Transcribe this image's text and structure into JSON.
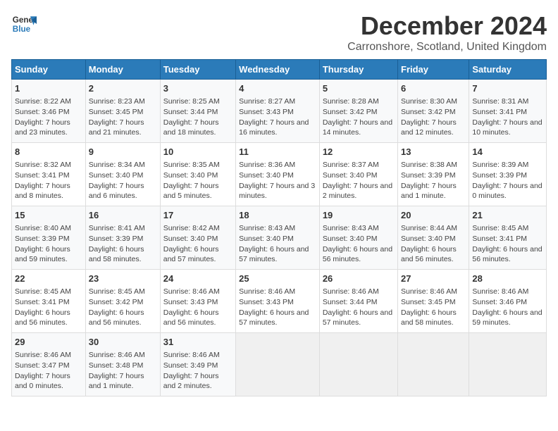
{
  "header": {
    "logo_line1": "General",
    "logo_line2": "Blue",
    "month": "December 2024",
    "location": "Carronshore, Scotland, United Kingdom"
  },
  "days_of_week": [
    "Sunday",
    "Monday",
    "Tuesday",
    "Wednesday",
    "Thursday",
    "Friday",
    "Saturday"
  ],
  "weeks": [
    [
      {
        "day": "1",
        "sunrise": "8:22 AM",
        "sunset": "3:46 PM",
        "daylight": "7 hours and 23 minutes."
      },
      {
        "day": "2",
        "sunrise": "8:23 AM",
        "sunset": "3:45 PM",
        "daylight": "7 hours and 21 minutes."
      },
      {
        "day": "3",
        "sunrise": "8:25 AM",
        "sunset": "3:44 PM",
        "daylight": "7 hours and 18 minutes."
      },
      {
        "day": "4",
        "sunrise": "8:27 AM",
        "sunset": "3:43 PM",
        "daylight": "7 hours and 16 minutes."
      },
      {
        "day": "5",
        "sunrise": "8:28 AM",
        "sunset": "3:42 PM",
        "daylight": "7 hours and 14 minutes."
      },
      {
        "day": "6",
        "sunrise": "8:30 AM",
        "sunset": "3:42 PM",
        "daylight": "7 hours and 12 minutes."
      },
      {
        "day": "7",
        "sunrise": "8:31 AM",
        "sunset": "3:41 PM",
        "daylight": "7 hours and 10 minutes."
      }
    ],
    [
      {
        "day": "8",
        "sunrise": "8:32 AM",
        "sunset": "3:41 PM",
        "daylight": "7 hours and 8 minutes."
      },
      {
        "day": "9",
        "sunrise": "8:34 AM",
        "sunset": "3:40 PM",
        "daylight": "7 hours and 6 minutes."
      },
      {
        "day": "10",
        "sunrise": "8:35 AM",
        "sunset": "3:40 PM",
        "daylight": "7 hours and 5 minutes."
      },
      {
        "day": "11",
        "sunrise": "8:36 AM",
        "sunset": "3:40 PM",
        "daylight": "7 hours and 3 minutes."
      },
      {
        "day": "12",
        "sunrise": "8:37 AM",
        "sunset": "3:40 PM",
        "daylight": "7 hours and 2 minutes."
      },
      {
        "day": "13",
        "sunrise": "8:38 AM",
        "sunset": "3:39 PM",
        "daylight": "7 hours and 1 minute."
      },
      {
        "day": "14",
        "sunrise": "8:39 AM",
        "sunset": "3:39 PM",
        "daylight": "7 hours and 0 minutes."
      }
    ],
    [
      {
        "day": "15",
        "sunrise": "8:40 AM",
        "sunset": "3:39 PM",
        "daylight": "6 hours and 59 minutes."
      },
      {
        "day": "16",
        "sunrise": "8:41 AM",
        "sunset": "3:39 PM",
        "daylight": "6 hours and 58 minutes."
      },
      {
        "day": "17",
        "sunrise": "8:42 AM",
        "sunset": "3:40 PM",
        "daylight": "6 hours and 57 minutes."
      },
      {
        "day": "18",
        "sunrise": "8:43 AM",
        "sunset": "3:40 PM",
        "daylight": "6 hours and 57 minutes."
      },
      {
        "day": "19",
        "sunrise": "8:43 AM",
        "sunset": "3:40 PM",
        "daylight": "6 hours and 56 minutes."
      },
      {
        "day": "20",
        "sunrise": "8:44 AM",
        "sunset": "3:40 PM",
        "daylight": "6 hours and 56 minutes."
      },
      {
        "day": "21",
        "sunrise": "8:45 AM",
        "sunset": "3:41 PM",
        "daylight": "6 hours and 56 minutes."
      }
    ],
    [
      {
        "day": "22",
        "sunrise": "8:45 AM",
        "sunset": "3:41 PM",
        "daylight": "6 hours and 56 minutes."
      },
      {
        "day": "23",
        "sunrise": "8:45 AM",
        "sunset": "3:42 PM",
        "daylight": "6 hours and 56 minutes."
      },
      {
        "day": "24",
        "sunrise": "8:46 AM",
        "sunset": "3:43 PM",
        "daylight": "6 hours and 56 minutes."
      },
      {
        "day": "25",
        "sunrise": "8:46 AM",
        "sunset": "3:43 PM",
        "daylight": "6 hours and 57 minutes."
      },
      {
        "day": "26",
        "sunrise": "8:46 AM",
        "sunset": "3:44 PM",
        "daylight": "6 hours and 57 minutes."
      },
      {
        "day": "27",
        "sunrise": "8:46 AM",
        "sunset": "3:45 PM",
        "daylight": "6 hours and 58 minutes."
      },
      {
        "day": "28",
        "sunrise": "8:46 AM",
        "sunset": "3:46 PM",
        "daylight": "6 hours and 59 minutes."
      }
    ],
    [
      {
        "day": "29",
        "sunrise": "8:46 AM",
        "sunset": "3:47 PM",
        "daylight": "7 hours and 0 minutes."
      },
      {
        "day": "30",
        "sunrise": "8:46 AM",
        "sunset": "3:48 PM",
        "daylight": "7 hours and 1 minute."
      },
      {
        "day": "31",
        "sunrise": "8:46 AM",
        "sunset": "3:49 PM",
        "daylight": "7 hours and 2 minutes."
      },
      null,
      null,
      null,
      null
    ]
  ],
  "labels": {
    "sunrise": "Sunrise:",
    "sunset": "Sunset:",
    "daylight": "Daylight:"
  }
}
